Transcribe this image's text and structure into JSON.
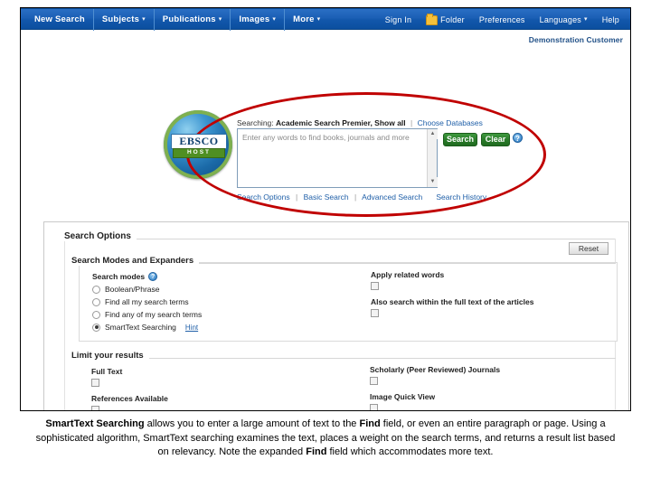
{
  "topnav": {
    "left_items": [
      {
        "label": "New Search",
        "caret": false
      },
      {
        "label": "Subjects",
        "caret": true
      },
      {
        "label": "Publications",
        "caret": true
      },
      {
        "label": "Images",
        "caret": true
      },
      {
        "label": "More",
        "caret": true
      }
    ],
    "right_items": [
      {
        "label": "Sign In",
        "icon": ""
      },
      {
        "label": "Folder",
        "icon": "folder-icon"
      },
      {
        "label": "Preferences",
        "icon": ""
      },
      {
        "label": "Languages",
        "icon": "",
        "caret": true
      },
      {
        "label": "Help",
        "icon": ""
      }
    ],
    "bg_color": "#1257ab"
  },
  "customer": "Demonstration Customer",
  "logo": {
    "primary": "EBSCO",
    "secondary": "HOST"
  },
  "search": {
    "searching_prefix": "Searching:",
    "database": "Academic Search Premier, Show all",
    "choose_databases": "Choose Databases",
    "find_placeholder": "Enter any words to find books, journals and more",
    "find_value": "",
    "search_button": "Search",
    "clear_button": "Clear",
    "help_icon": "help-icon",
    "scroll_up": "▲",
    "scroll_down": "▼",
    "links": [
      "Search Options",
      "Basic Search",
      "Advanced Search",
      "Search History"
    ],
    "annotation_color": "#c00000"
  },
  "panel": {
    "title": "Search Options",
    "reset_label": "Reset",
    "modes": {
      "section_title": "Search Modes and Expanders",
      "group_label": "Search modes",
      "group_help_icon": "help-icon",
      "options": [
        {
          "label": "Boolean/Phrase",
          "selected": false
        },
        {
          "label": "Find all my search terms",
          "selected": false
        },
        {
          "label": "Find any of my search terms",
          "selected": false
        },
        {
          "label": "SmartText Searching",
          "selected": true,
          "hint": "Hint"
        }
      ],
      "expanders": [
        {
          "label": "Apply related words",
          "checked": false
        },
        {
          "label": "Also search within the full text of the articles",
          "checked": false
        }
      ]
    },
    "limit": {
      "section_title": "Limit your results",
      "left": [
        {
          "label": "Full Text",
          "checked": false
        },
        {
          "label": "References Available",
          "checked": false
        }
      ],
      "right": [
        {
          "label": "Scholarly (Peer Reviewed) Journals",
          "checked": false
        },
        {
          "label": "Image Quick View",
          "checked": false
        }
      ]
    }
  },
  "caption": {
    "p1_bold": "SmartText Searching",
    "p1": " allows you to enter a large amount of text to the ",
    "p2_bold": "Find",
    "p2": " field, or even an entire paragraph or page. Using a sophisticated algorithm, SmartText searching examines the text, places a weight on the search terms, and returns a result list based on relevancy. Note the expanded ",
    "p3_bold": "Find",
    "p3": " field which accommodates more text."
  }
}
